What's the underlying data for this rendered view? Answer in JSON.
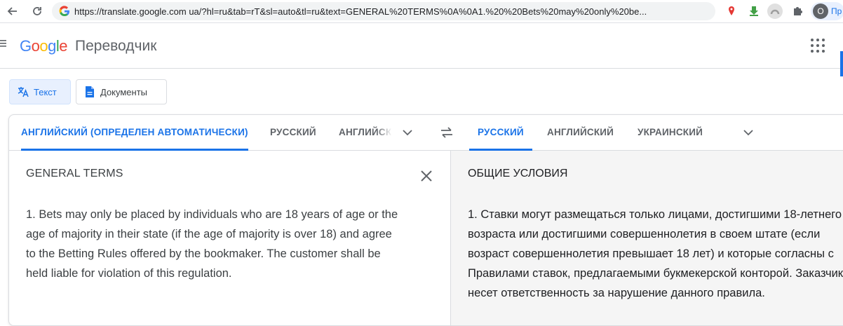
{
  "browser": {
    "url": "https://translate.google.com ua/?hl=ru&tab=rT&sl=auto&tl=ru&text=GENERAL%20TERMS%0A%0A1.%20%20Bets%20may%20only%20be...",
    "profile_initial": "О",
    "profile_label": "Пр",
    "icons": [
      "back-arrow-icon",
      "forward-arrow-icon",
      "reload-icon",
      "google-g-icon",
      "location-pin-extension-icon",
      "download-extension-icon",
      "vpn-extension-icon",
      "puzzle-extensions-icon"
    ]
  },
  "header": {
    "logo_letters": [
      {
        "ch": "G",
        "color": "#4285F4"
      },
      {
        "ch": "o",
        "color": "#EA4335"
      },
      {
        "ch": "o",
        "color": "#FBBC05"
      },
      {
        "ch": "g",
        "color": "#4285F4"
      },
      {
        "ch": "l",
        "color": "#34A853"
      },
      {
        "ch": "e",
        "color": "#EA4335"
      }
    ],
    "product_name": "Переводчик"
  },
  "modes": {
    "text_label": "Текст",
    "documents_label": "Документы"
  },
  "source_languages": [
    "АНГЛИЙСКИЙ (ОПРЕДЕЛЕН АВТОМАТИЧЕСКИ)",
    "РУССКИЙ",
    "АНГЛИЙСКИЙ"
  ],
  "target_languages": [
    "РУССКИЙ",
    "АНГЛИЙСКИЙ",
    "УКРАИНСКИЙ"
  ],
  "source": {
    "title": "GENERAL TERMS",
    "body": "1.  Bets may only be placed by individuals who are 18 years of age or the age of majority in their state (if the age of majority is over 18) and agree to the Betting Rules offered by the bookmaker. The customer shall be held liable for violation of this regulation."
  },
  "target": {
    "title": "ОБЩИЕ УСЛОВИЯ",
    "body": "1. Ставки могут размещаться только лицами, достигшими 18-летнего возраста или достигшими совершеннолетия в своем штате (если возраст совершеннолетия превышает 18 лет) и которые согласны с Правилами ставок, предлагаемыми букмекерской конторой. Заказчик несет ответственность за нарушение данного правила."
  },
  "colors": {
    "accent": "#1a73e8",
    "target_pane_bg": "#f5f5f5"
  }
}
